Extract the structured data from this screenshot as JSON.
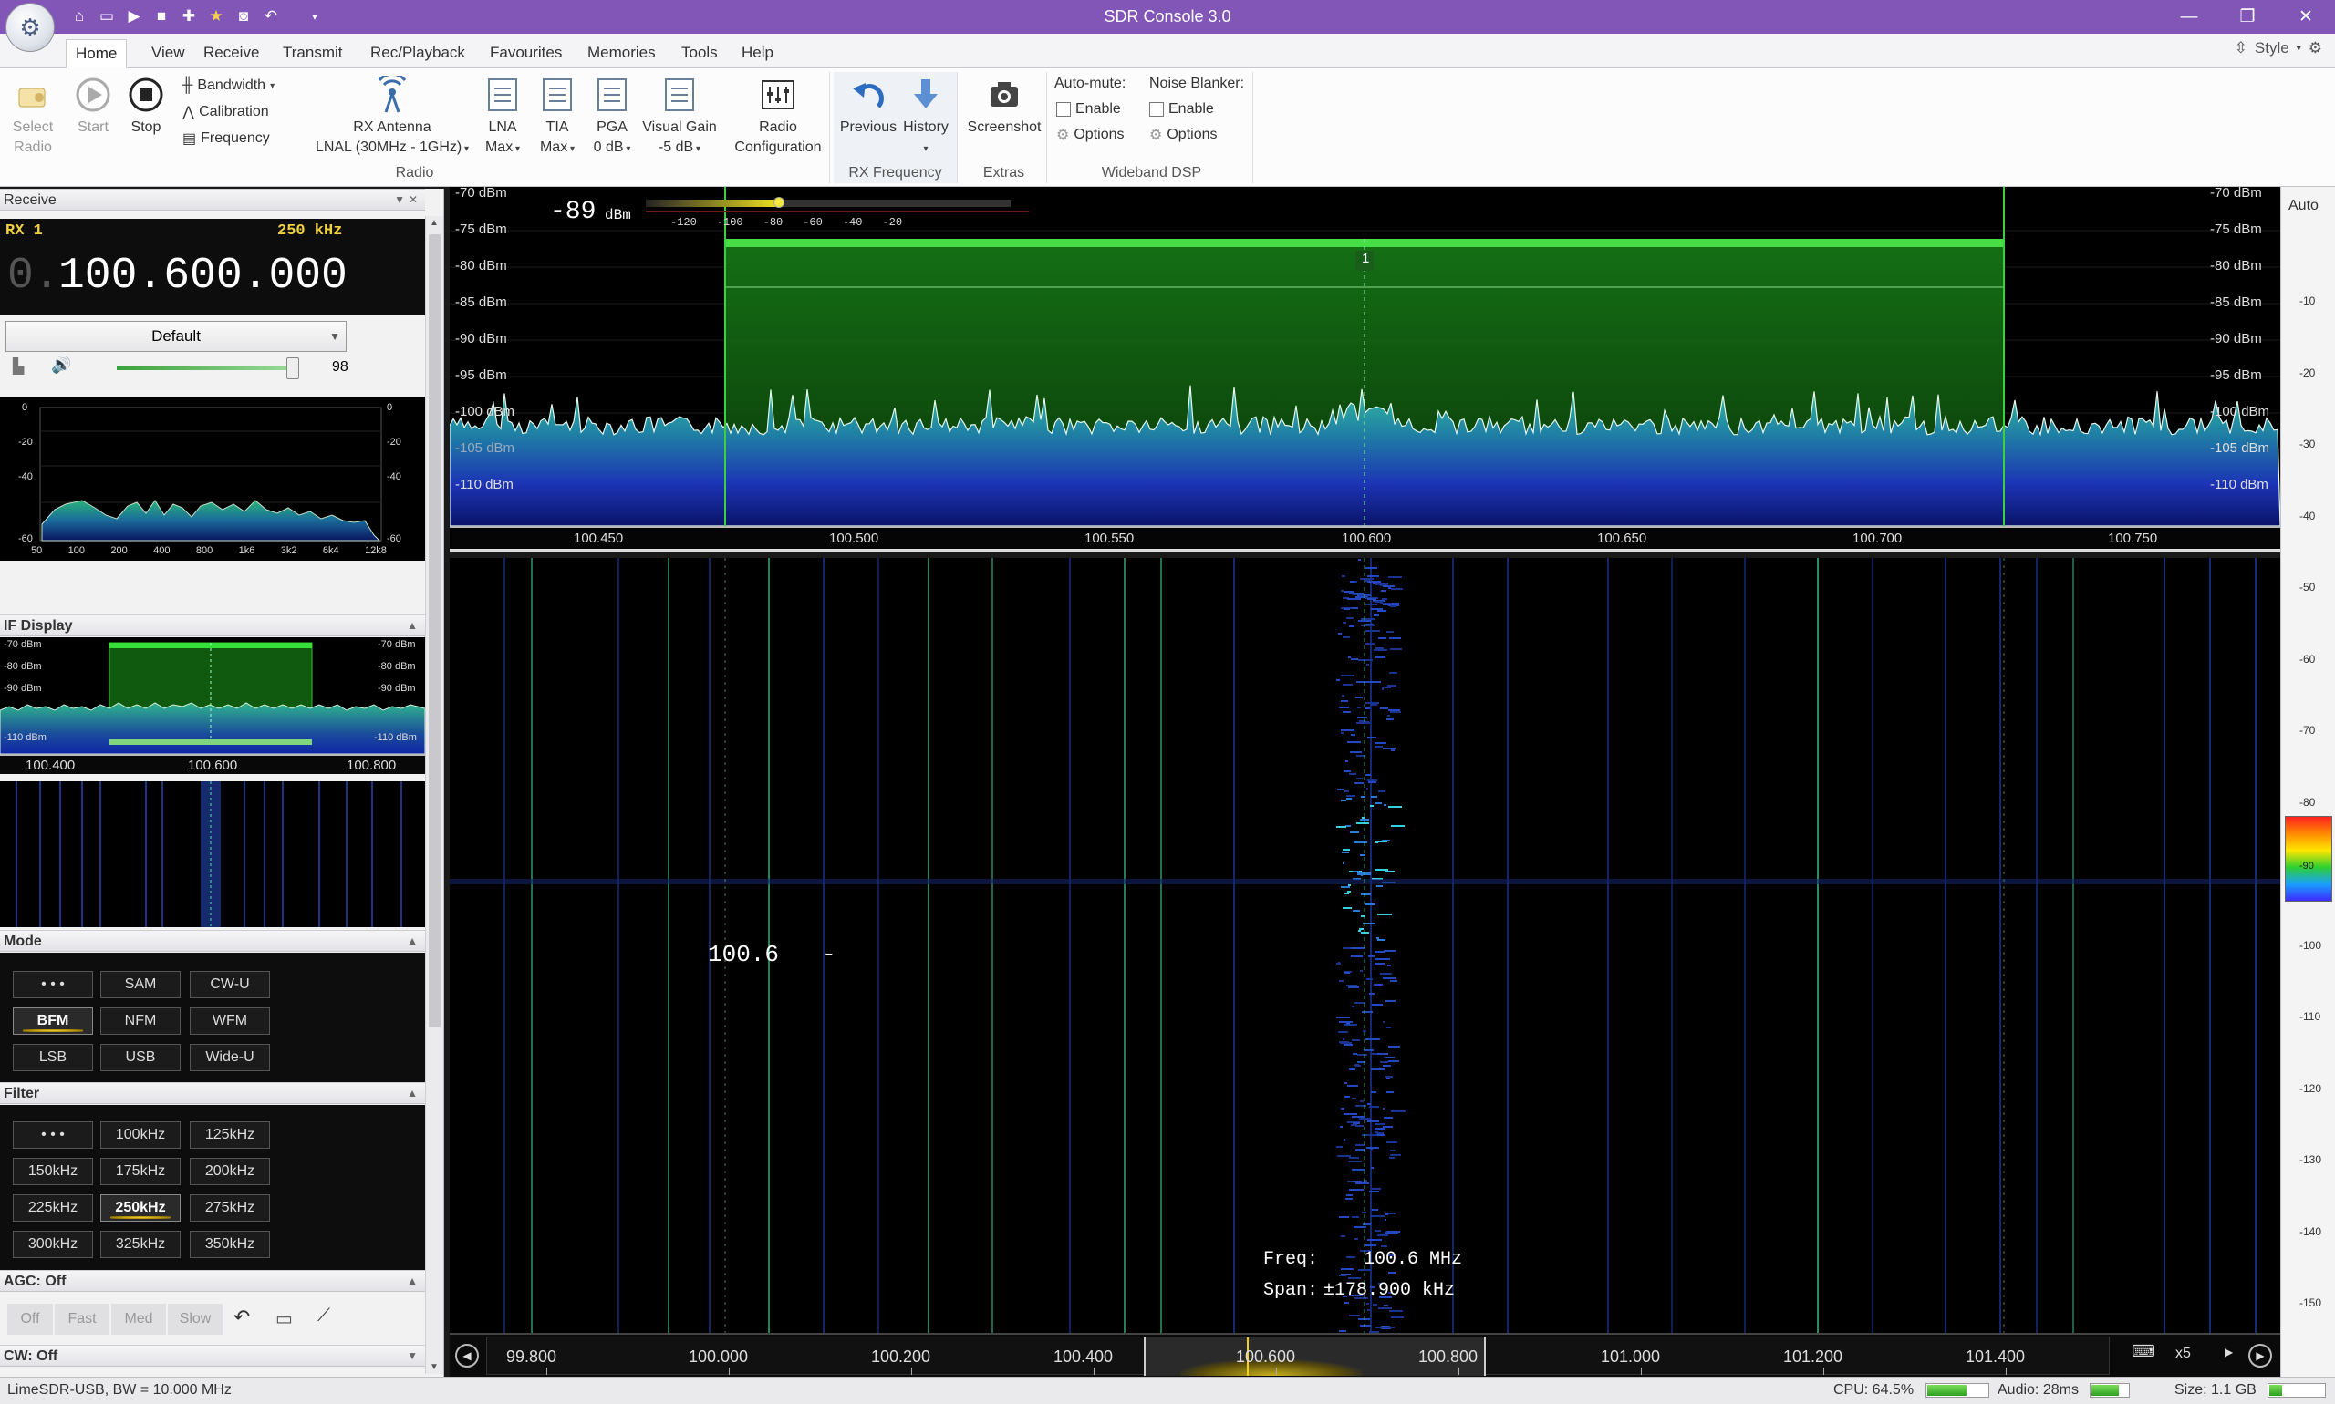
{
  "window": {
    "title": "SDR Console 3.0",
    "controls": [
      "minimize",
      "maximize",
      "close"
    ]
  },
  "ribbon_tabs": [
    "Home",
    "View",
    "Receive",
    "Transmit",
    "Rec/Playback",
    "Favourites",
    "Memories",
    "Tools",
    "Help"
  ],
  "style_menu": "Style",
  "ribbon": {
    "select_radio": "Select Radio",
    "start": "Start",
    "stop": "Stop",
    "bandwidth": "Bandwidth",
    "calibration": "Calibration",
    "frequency": "Frequency",
    "rx_antenna": "RX Antenna",
    "rx_antenna_value": "LNAL (30MHz - 1GHz)",
    "lna": "LNA",
    "lna_value": "Max",
    "tia": "TIA",
    "tia_value": "Max",
    "pga": "PGA",
    "pga_value": "0 dB",
    "visual_gain": "Visual Gain",
    "visual_gain_value": "-5 dB",
    "radio_configuration": "Radio Configuration",
    "group_radio": "Radio",
    "previous": "Previous",
    "history": "History",
    "group_rx_frequency": "RX Frequency",
    "screenshot": "Screenshot",
    "group_extras": "Extras",
    "auto_mute": "Auto-mute:",
    "auto_mute_enable": "Enable",
    "auto_mute_options": "Options",
    "noise_blanker": "Noise Blanker:",
    "nb_enable": "Enable",
    "nb_options": "Options",
    "group_wideband_dsp": "Wideband DSP"
  },
  "receive_panel": {
    "header": "Receive",
    "rx_label": "RX 1",
    "bandwidth": "250 kHz",
    "freq_prefix": "0.",
    "frequency": "100.600.000",
    "profile": "Default",
    "volume": "98",
    "volume_level": 0.98
  },
  "audio_spectrum": {
    "y_ticks_left": [
      "0",
      "-20",
      "-40",
      "-60"
    ],
    "y_ticks_right": [
      "0",
      "-20",
      "-40",
      "-60"
    ],
    "x_ticks": [
      "50",
      "100",
      "200",
      "400",
      "800",
      "1k6",
      "3k2",
      "6k4",
      "12k8"
    ]
  },
  "if_display": {
    "header": "IF Display",
    "levels_left": [
      "-70 dBm",
      "-80 dBm",
      "-90 dBm",
      "-110 dBm"
    ],
    "levels_right": [
      "-70 dBm",
      "-80 dBm",
      "-90 dBm",
      "-110 dBm"
    ],
    "freq_ticks": [
      "100.400",
      "100.600",
      "100.800"
    ]
  },
  "mode": {
    "header": "Mode",
    "buttons": [
      "• • •",
      "SAM",
      "CW-U",
      "BFM",
      "NFM",
      "WFM",
      "LSB",
      "USB",
      "Wide-U"
    ],
    "selected": "BFM"
  },
  "filter": {
    "header": "Filter",
    "buttons": [
      "• • •",
      "100kHz",
      "125kHz",
      "150kHz",
      "175kHz",
      "200kHz",
      "225kHz",
      "250kHz",
      "275kHz",
      "300kHz",
      "325kHz",
      "350kHz"
    ],
    "selected": "250kHz"
  },
  "agc": {
    "header": "AGC: Off",
    "buttons": [
      "Off",
      "Fast",
      "Med",
      "Slow"
    ]
  },
  "cw": {
    "header": "CW: Off"
  },
  "spectrum": {
    "signal_level": "-89",
    "signal_unit": "dBm",
    "meter_scale": [
      "-120",
      "-100",
      "-80",
      "-60",
      "-40",
      "-20"
    ],
    "meter_level": -89,
    "dbm_left": [
      "-70 dBm",
      "-75 dBm",
      "-80 dBm",
      "-85 dBm",
      "-90 dBm",
      "-95 dBm",
      "-100 dBm",
      "-105 dBm",
      "-110 dBm"
    ],
    "dbm_right": [
      "-70 dBm",
      "-75 dBm",
      "-80 dBm",
      "-85 dBm",
      "-90 dBm",
      "-95 dBm",
      "-100 dBm",
      "-105 dBm",
      "-110 dBm"
    ],
    "filter_marker": "1",
    "freq_ticks": [
      "100.450",
      "100.500",
      "100.550",
      "100.600",
      "100.650",
      "100.700",
      "100.750"
    ]
  },
  "waterfall": {
    "frequency_label": "100.6",
    "frequency_dash": "-",
    "freq_readout_label": "Freq:",
    "freq_readout_value": "100.6 MHz",
    "span_label": "Span:",
    "span_value": "±178.900 kHz",
    "bottom_ticks": [
      "99.800",
      "100.000",
      "100.200",
      "100.400",
      "100.600",
      "100.800",
      "101.000",
      "101.200",
      "101.400"
    ],
    "zoom": "x5"
  },
  "right_axis": {
    "auto": "Auto",
    "ticks": [
      "-10",
      "-20",
      "-30",
      "-40",
      "-50",
      "-60",
      "-70",
      "-80",
      "-90",
      "-100",
      "-110",
      "-120",
      "-130",
      "-140",
      "-150"
    ]
  },
  "statusbar": {
    "device": "LimeSDR-USB, BW = 10.000 MHz",
    "cpu": "CPU: 64.5%",
    "cpu_level": 0.645,
    "audio": "Audio: 28ms",
    "size": "Size: 1.1 GB"
  }
}
